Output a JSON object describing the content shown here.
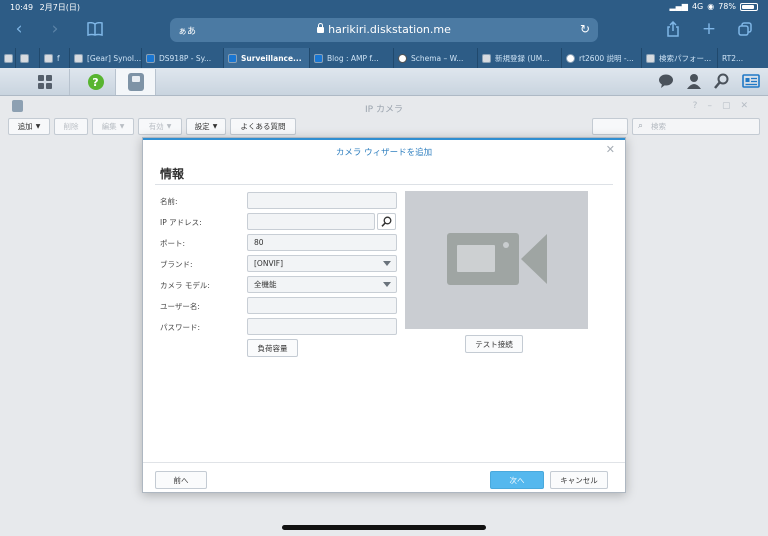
{
  "status_bar": {
    "time": "10:49",
    "date": "2月7日(日)",
    "network": "4G",
    "battery": "78%"
  },
  "safari": {
    "aa": "ぁあ",
    "url": "harikiri.diskstation.me",
    "tabs": [
      {
        "label": ""
      },
      {
        "label": "f"
      },
      {
        "label": "[Gear] Synol..."
      },
      {
        "label": "DS918P - Sy..."
      },
      {
        "label": "Surveillance..."
      },
      {
        "label": "Blog : AMP f..."
      },
      {
        "label": "Schema – W..."
      },
      {
        "label": "新規登録 (UM..."
      },
      {
        "label": "rt2600 説明 -..."
      },
      {
        "label": "検索パフォー..."
      },
      {
        "label": "RT2..."
      }
    ]
  },
  "app": {
    "title": "IP カメラ",
    "toolbar": {
      "add": "追加",
      "delete": "削除",
      "edit": "編集",
      "enable": "有効",
      "settings": "設定",
      "faq": "よくある質問",
      "search_placeholder": "検索"
    }
  },
  "modal": {
    "title": "カメラ ウィザードを追加",
    "section": "情報",
    "labels": {
      "name": "名前:",
      "ip": "IP アドレス:",
      "port": "ポート:",
      "brand": "ブランド:",
      "model": "カメラ モデル:",
      "user": "ユーザー名:",
      "password": "パスワード:"
    },
    "values": {
      "name": "",
      "ip": "",
      "port": "80",
      "brand": "[ONVIF]",
      "model": "全機能",
      "user": "",
      "password": ""
    },
    "buttons": {
      "capability": "負荷容量",
      "test": "テスト接続",
      "back": "前へ",
      "next": "次へ",
      "cancel": "キャンセル"
    }
  }
}
